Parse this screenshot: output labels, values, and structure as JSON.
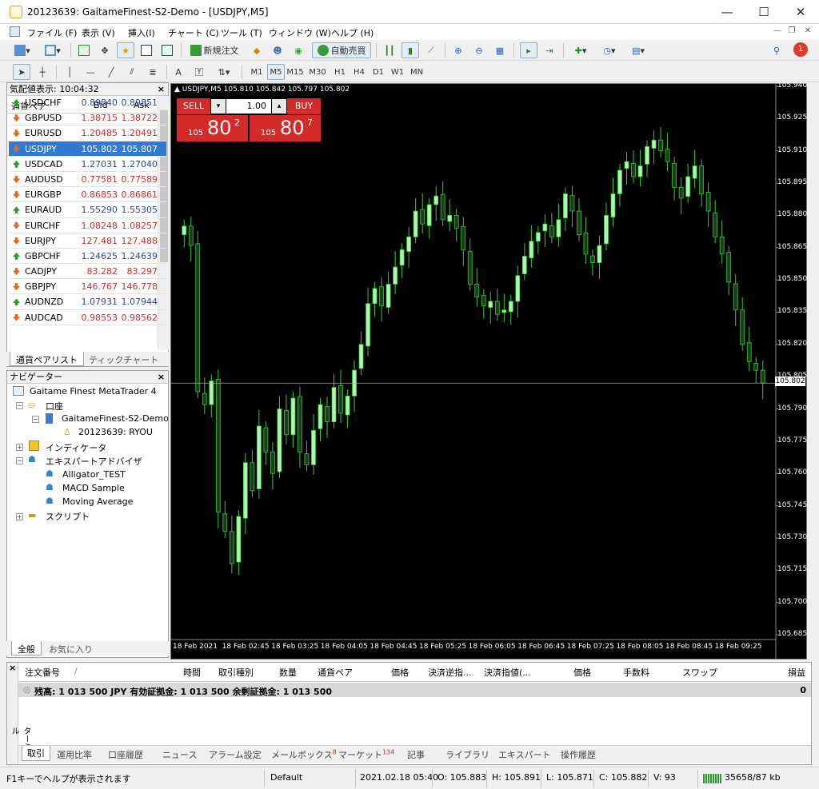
{
  "window": {
    "title": "20123639: GaitameFinest-S2-Demo - [USDJPY,M5]",
    "minimize": "—",
    "maximize": "☐",
    "close": "✕"
  },
  "menu": [
    "ファイル (F)",
    "表示 (V)",
    "挿入(I)",
    "チャート (C)",
    "ツール (T)",
    "ウィンドウ (W)",
    "ヘルプ (H)"
  ],
  "toolbar": {
    "new_order": "新規注文",
    "auto_trade": "自動売買",
    "notify_count": "1"
  },
  "timeframes": [
    "M1",
    "M5",
    "M15",
    "M30",
    "H1",
    "H4",
    "D1",
    "W1",
    "MN"
  ],
  "active_timeframe": "M5",
  "market_watch": {
    "title": "気配値表示: 10:04:32",
    "col_symbol": "通貨ペア",
    "col_bid": "Bid",
    "col_ask": "Ask",
    "rows": [
      {
        "symbol": "USDCHF",
        "bid": "0.89840",
        "ask": "0.89851",
        "dir": "up"
      },
      {
        "symbol": "GBPUSD",
        "bid": "1.38715",
        "ask": "1.38722",
        "dir": "down"
      },
      {
        "symbol": "EURUSD",
        "bid": "1.20485",
        "ask": "1.20491",
        "dir": "down"
      },
      {
        "symbol": "USDJPY",
        "bid": "105.802",
        "ask": "105.807",
        "dir": "down",
        "selected": true
      },
      {
        "symbol": "USDCAD",
        "bid": "1.27031",
        "ask": "1.27040",
        "dir": "up"
      },
      {
        "symbol": "AUDUSD",
        "bid": "0.77581",
        "ask": "0.77589",
        "dir": "down"
      },
      {
        "symbol": "EURGBP",
        "bid": "0.86853",
        "ask": "0.86861",
        "dir": "down"
      },
      {
        "symbol": "EURAUD",
        "bid": "1.55290",
        "ask": "1.55305",
        "dir": "up"
      },
      {
        "symbol": "EURCHF",
        "bid": "1.08248",
        "ask": "1.08257",
        "dir": "down"
      },
      {
        "symbol": "EURJPY",
        "bid": "127.481",
        "ask": "127.488",
        "dir": "down"
      },
      {
        "symbol": "GBPCHF",
        "bid": "1.24625",
        "ask": "1.24639",
        "dir": "up"
      },
      {
        "symbol": "CADJPY",
        "bid": "83.282",
        "ask": "83.297",
        "dir": "down"
      },
      {
        "symbol": "GBPJPY",
        "bid": "146.767",
        "ask": "146.778",
        "dir": "down"
      },
      {
        "symbol": "AUDNZD",
        "bid": "1.07931",
        "ask": "1.07944",
        "dir": "up"
      },
      {
        "symbol": "AUDCAD",
        "bid": "0.98553",
        "ask": "0.98562",
        "dir": "down"
      }
    ],
    "tab_symbols": "通貨ペアリスト",
    "tab_tick": "ティックチャート"
  },
  "navigator": {
    "title": "ナビゲーター",
    "root": "Gaitame Finest MetaTrader 4",
    "accounts": "口座",
    "server": "GaitameFinest-S2-Demo",
    "account": "20123639: RYOU",
    "indicators": "インディケータ",
    "experts": "エキスパートアドバイザ",
    "ea_items": [
      "Alligator_TEST",
      "MACD Sample",
      "Moving Average"
    ],
    "scripts": "スクリプト",
    "tab_general": "全般",
    "tab_favorites": "お気に入り"
  },
  "chart": {
    "header": "USDJPY,M5  105.810 105.842 105.797 105.802",
    "sell_label": "SELL",
    "buy_label": "BUY",
    "lot": "1.00",
    "sell_prefix": "105",
    "sell_big": "80",
    "sell_sup": "2",
    "buy_prefix": "105",
    "buy_big": "80",
    "buy_sup": "7",
    "current_price": "105.802"
  },
  "chart_data": {
    "type": "candlestick",
    "symbol": "USDJPY",
    "timeframe": "M5",
    "ylim": [
      105.685,
      105.94
    ],
    "yticks": [
      "105.940",
      "105.925",
      "105.910",
      "105.895",
      "105.880",
      "105.865",
      "105.850",
      "105.835",
      "105.820",
      "105.805",
      "105.790",
      "105.775",
      "105.760",
      "105.745",
      "105.730",
      "105.715",
      "105.700",
      "105.685"
    ],
    "xticks": [
      "18 Feb 2021",
      "18 Feb 02:45",
      "18 Feb 03:25",
      "18 Feb 04:05",
      "18 Feb 04:45",
      "18 Feb 05:25",
      "18 Feb 06:05",
      "18 Feb 06:45",
      "18 Feb 07:25",
      "18 Feb 08:05",
      "18 Feb 08:45",
      "18 Feb 09:25"
    ],
    "last": 105.802,
    "closes": [
      105.875,
      105.866,
      105.798,
      105.792,
      105.803,
      105.742,
      105.733,
      105.718,
      105.74,
      105.765,
      105.752,
      105.782,
      105.77,
      105.76,
      105.79,
      105.778,
      105.795,
      105.77,
      105.764,
      105.78,
      105.792,
      105.784,
      105.8,
      105.788,
      105.796,
      105.808,
      105.82,
      105.839,
      105.846,
      105.838,
      105.848,
      105.856,
      105.864,
      105.87,
      105.882,
      105.876,
      105.885,
      105.889,
      105.878,
      105.88,
      105.874,
      105.864,
      105.848,
      105.842,
      105.838,
      105.84,
      105.834,
      105.836,
      105.84,
      105.852,
      105.861,
      105.868,
      105.872,
      105.876,
      105.87,
      105.878,
      105.89,
      105.882,
      105.871,
      105.862,
      105.858,
      105.866,
      105.88,
      105.89,
      105.901,
      105.905,
      105.898,
      105.903,
      105.912,
      105.915,
      105.91,
      105.905,
      105.893,
      105.888,
      105.898,
      105.903,
      105.89,
      105.882,
      105.87,
      105.862,
      105.849,
      105.836,
      105.82,
      105.812,
      105.808,
      105.802
    ]
  },
  "terminal": {
    "side_label": "ターミナル",
    "cols": [
      "注文番号",
      "時間",
      "取引種別",
      "数量",
      "通貨ペア",
      "価格",
      "決済逆指...",
      "決済指値(...",
      "価格",
      "手数料",
      "スワップ",
      "損益"
    ],
    "balance_line": "残高: 1 013 500 JPY  有効証拠金: 1 013 500  余剰証拠金: 1 013 500",
    "balance_value": "0",
    "tabs": [
      "取引",
      "運用比率",
      "口座履歴",
      "ニュース",
      "アラーム設定",
      "メールボックス",
      "マーケット",
      "記事",
      "ライブラリ",
      "エキスパート",
      "操作履歴"
    ],
    "mail_badge": "8",
    "market_badge": "134"
  },
  "status": {
    "help": "F1キーでヘルプが表示されます",
    "profile": "Default",
    "datetime": "2021.02.18 05:40",
    "open": "O: 105.883",
    "high": "H: 105.891",
    "low": "L: 105.871",
    "close": "C: 105.882",
    "volume": "V: 93",
    "traffic": "35658/87 kb"
  },
  "colors": {
    "bull": "#aef7ae",
    "bear": "#1a3d1a",
    "wick": "#33cc33",
    "axis_text": "#ffffff",
    "sell_red": "#d42a2a",
    "selected_row": "#3279d1"
  }
}
